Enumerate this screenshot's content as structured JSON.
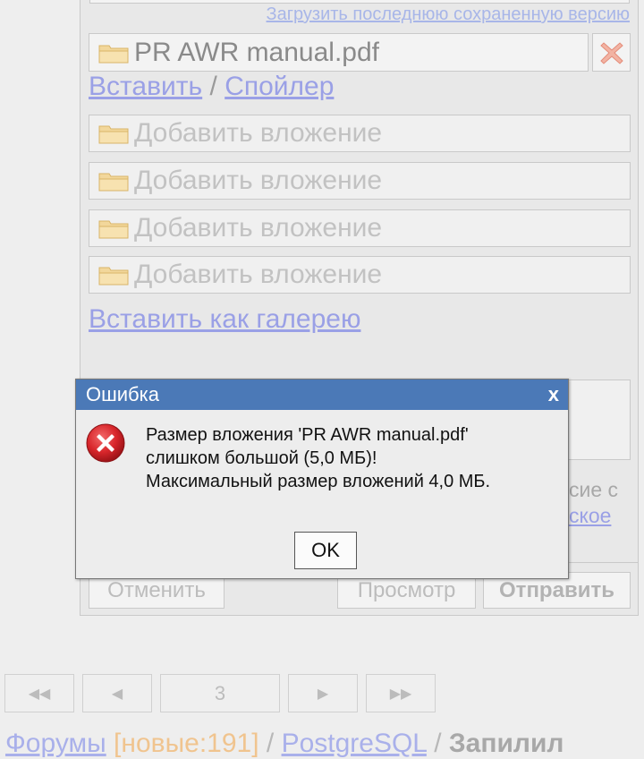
{
  "form": {
    "restore_link": "Загрузить последнюю сохраненную версию",
    "attached_file": "PR AWR manual.pdf",
    "insert_link": "Вставить",
    "separator": " / ",
    "spoiler_link": "Спойлер",
    "add_attachment_slots": [
      "Добавить вложение",
      "Добавить вложение",
      "Добавить вложение",
      "Добавить вложение"
    ],
    "gallery_link": "Вставить как галерею",
    "behind_text_1": "сие с",
    "behind_text_2": "ское",
    "cancel_button": "Отменить",
    "preview_button": "Просмотр",
    "submit_button": "Отправить"
  },
  "pager": {
    "first": "◀◀",
    "prev": "◀",
    "page": "3",
    "next": "▶",
    "last": "▶▶"
  },
  "footer": {
    "forums_link": "Форумы",
    "new_count": "[новые:191]",
    "separator": " / ",
    "section_link": "PostgreSQL",
    "topic_title": "Запилил"
  },
  "dialog": {
    "title": "Ошибка",
    "close": "x",
    "icon": "error-icon",
    "message_line1": "Размер вложения 'PR AWR manual.pdf'",
    "message_line2": "слишком большой (5,0 МБ)!",
    "message_line3": "Максимальный размер вложений 4,0 МБ.",
    "ok_button": "OK"
  },
  "colors": {
    "title_bar": "#4b79b7",
    "link": "#9aa0e6",
    "error_red": "#d8262b"
  }
}
